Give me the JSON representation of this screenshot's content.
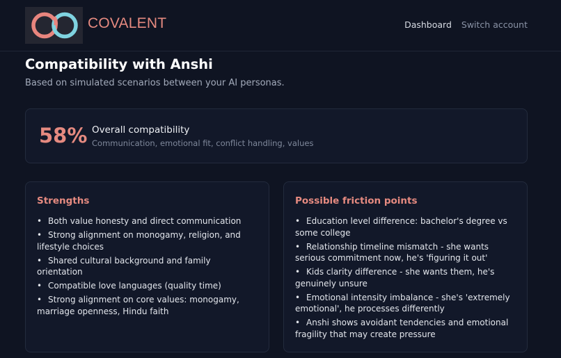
{
  "header": {
    "brand": "COVALENT",
    "logo_icon": "interlocking-rings-logo",
    "nav": {
      "dashboard": "Dashboard",
      "switch_account": "Switch account"
    }
  },
  "page": {
    "title": "Compatibility with Anshi",
    "subtitle": "Based on simulated scenarios between your AI personas."
  },
  "summary": {
    "score": "58%",
    "label": "Overall compatibility",
    "description": "Communication, emotional fit, conflict handling, values"
  },
  "strengths": {
    "title": "Strengths",
    "items": [
      "Both value honesty and direct communication",
      "Strong alignment on monogamy, religion, and lifestyle choices",
      "Shared cultural background and family orientation",
      "Compatible love languages (quality time)",
      "Strong alignment on core values: monogamy, marriage openness, Hindu faith"
    ]
  },
  "friction": {
    "title": "Possible friction points",
    "items": [
      "Education level difference: bachelor's degree vs some college",
      "Relationship timeline mismatch - she wants serious commitment now, he's 'figuring it out'",
      "Kids clarity difference - she wants them, he's genuinely unsure",
      "Emotional intensity imbalance - she's 'extremely emotional', he processes differently",
      "Anshi shows avoidant tendencies and emotional fragility that may create pressure"
    ]
  },
  "colors": {
    "background": "#0f1422",
    "card": "#121829",
    "accent": "#e58a80",
    "logo_coral": "#e8857e",
    "logo_teal": "#7fd3e0"
  }
}
